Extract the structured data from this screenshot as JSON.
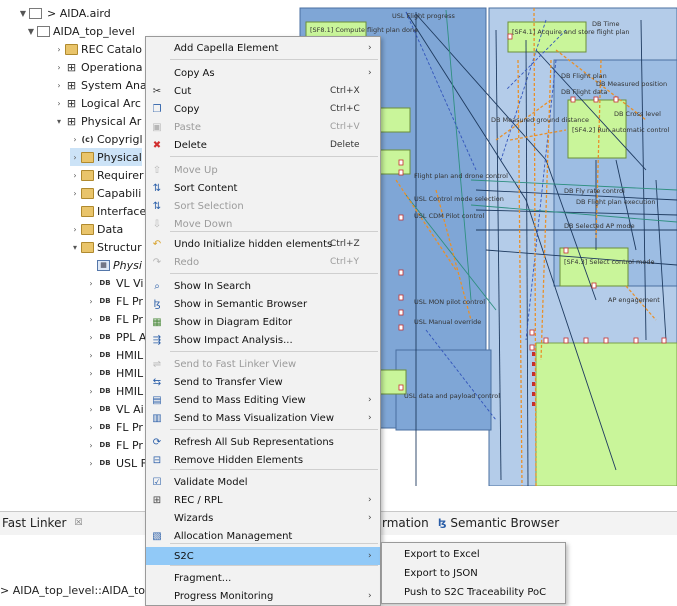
{
  "tree": {
    "rows": [
      {
        "label": "AIDA.aird",
        "icon": "doc-icon",
        "glyph": "",
        "prefix": "▾  ▤ >"
      },
      {
        "label": "AIDA_top_level",
        "icon": "doc-icon",
        "glyph": ""
      },
      {
        "label": "REC Catalo",
        "icon": "folder-icon",
        "glyph": ""
      },
      {
        "label": "Operationa",
        "icon": "grid-icon",
        "glyph": "⊞"
      },
      {
        "label": "System Ana",
        "icon": "grid-icon",
        "glyph": "⊞"
      },
      {
        "label": "Logical Arc",
        "icon": "grid-icon",
        "glyph": "⊞"
      },
      {
        "label": "Physical Ar",
        "icon": "grid-icon",
        "glyph": "⊞"
      },
      {
        "label": "Copyrigl",
        "icon": "copyright-icon",
        "glyph": "(c)"
      },
      {
        "label": "Physical",
        "icon": "folder-icon",
        "glyph": ""
      },
      {
        "label": "Requirer",
        "icon": "folder-icon",
        "glyph": ""
      },
      {
        "label": "Capabili",
        "icon": "folder-icon",
        "glyph": ""
      },
      {
        "label": "Interface",
        "icon": "folder-icon",
        "glyph": ""
      },
      {
        "label": "Data",
        "icon": "folder-icon",
        "glyph": ""
      },
      {
        "label": "Structur",
        "icon": "folder-icon",
        "glyph": ""
      },
      {
        "label": "Physi",
        "icon": "diagram-icon",
        "glyph": "▦"
      },
      {
        "label": "VL Vi",
        "icon": "db-icon",
        "glyph": "DB"
      },
      {
        "label": "FL Pr",
        "icon": "db-icon",
        "glyph": "DB"
      },
      {
        "label": "FL Pr",
        "icon": "db-icon",
        "glyph": "DB"
      },
      {
        "label": "PPL A",
        "icon": "db-icon",
        "glyph": "DB"
      },
      {
        "label": "HMIL",
        "icon": "db-icon",
        "glyph": "DB"
      },
      {
        "label": "HMIL",
        "icon": "db-icon",
        "glyph": "DB"
      },
      {
        "label": "HMIL",
        "icon": "db-icon",
        "glyph": "DB"
      },
      {
        "label": "VL Ai",
        "icon": "db-icon",
        "glyph": "DB"
      },
      {
        "label": "FL Pr",
        "icon": "db-icon",
        "glyph": "DB"
      },
      {
        "label": "FL Pr",
        "icon": "db-icon",
        "glyph": "DB"
      },
      {
        "label": "USL F",
        "icon": "db-icon",
        "glyph": "DB"
      }
    ]
  },
  "diagram": {
    "labels": [
      "[SF8.1] Compute flight plan done",
      "USL Flight progress",
      "[SF4.1] Acquire and store flight plan",
      "DB Time",
      "DB Flight plan",
      "DB Measured position",
      "DB Flight data",
      "DB Measured ground distance",
      "[SF4.2] Run automatic control",
      "DB Cross level",
      "Flight plan and drone control",
      "USL Control mode selection",
      "USL CDM Pilot control",
      "DB Flight plan execution",
      "DB Selected AP mode",
      "[SF4.3] Select control mode",
      "AP engagement",
      "USL MON pilot control",
      "USL Manual override",
      "USL data and payload control",
      "DB Fly rate control"
    ]
  },
  "menu": {
    "items": [
      {
        "label": "Add Capella Element",
        "shortcut": "",
        "arrow": "›",
        "icon": "none"
      },
      {
        "label": "Copy As",
        "shortcut": "",
        "arrow": "›",
        "icon": "none"
      },
      {
        "label": "Cut",
        "shortcut": "Ctrl+X",
        "arrow": "",
        "icon": "cut-icon"
      },
      {
        "label": "Copy",
        "shortcut": "Ctrl+C",
        "arrow": "",
        "icon": "copy-icon"
      },
      {
        "label": "Paste",
        "shortcut": "Ctrl+V",
        "arrow": "",
        "icon": "paste-icon"
      },
      {
        "label": "Delete",
        "shortcut": "Delete",
        "arrow": "",
        "icon": "delete-icon"
      },
      {
        "label": "Move Up",
        "shortcut": "",
        "arrow": "",
        "icon": "move-up-icon"
      },
      {
        "label": "Sort Content",
        "shortcut": "",
        "arrow": "",
        "icon": "sort-icon"
      },
      {
        "label": "Sort Selection",
        "shortcut": "",
        "arrow": "",
        "icon": "sort-icon"
      },
      {
        "label": "Move Down",
        "shortcut": "",
        "arrow": "",
        "icon": "move-down-icon"
      },
      {
        "label": "Undo Initialize hidden elements",
        "shortcut": "Ctrl+Z",
        "arrow": "",
        "icon": "undo-icon"
      },
      {
        "label": "Redo",
        "shortcut": "Ctrl+Y",
        "arrow": "",
        "icon": "redo-icon"
      },
      {
        "label": "Show In Search",
        "shortcut": "",
        "arrow": "",
        "icon": "search-icon"
      },
      {
        "label": "Show in Semantic Browser",
        "shortcut": "",
        "arrow": "",
        "icon": "browser-icon"
      },
      {
        "label": "Show in Diagram Editor",
        "shortcut": "",
        "arrow": "",
        "icon": "diagram-icon"
      },
      {
        "label": "Show Impact Analysis...",
        "shortcut": "",
        "arrow": "",
        "icon": "impact-icon"
      },
      {
        "label": "Send to Fast Linker View",
        "shortcut": "",
        "arrow": "",
        "icon": "linker-icon"
      },
      {
        "label": "Send to Transfer View",
        "shortcut": "",
        "arrow": "",
        "icon": "transfer-icon"
      },
      {
        "label": "Send to Mass Editing View",
        "shortcut": "",
        "arrow": "›",
        "icon": "mass-edit-icon"
      },
      {
        "label": "Send to Mass Visualization View",
        "shortcut": "",
        "arrow": "›",
        "icon": "mass-view-icon"
      },
      {
        "label": "Refresh All Sub Representations",
        "shortcut": "",
        "arrow": "",
        "icon": "refresh-icon"
      },
      {
        "label": "Remove Hidden Elements",
        "shortcut": "",
        "arrow": "",
        "icon": "remove-icon"
      },
      {
        "label": "Validate Model",
        "shortcut": "",
        "arrow": "",
        "icon": "validate-icon"
      },
      {
        "label": "REC / RPL",
        "shortcut": "",
        "arrow": "›",
        "icon": "grid-icon"
      },
      {
        "label": "Wizards",
        "shortcut": "",
        "arrow": "›",
        "icon": "none"
      },
      {
        "label": "Allocation Management",
        "shortcut": "",
        "arrow": "",
        "icon": "allocation-icon"
      },
      {
        "label": "S2C",
        "shortcut": "",
        "arrow": "›",
        "icon": "none"
      },
      {
        "label": "Fragment...",
        "shortcut": "",
        "arrow": "",
        "icon": "none"
      },
      {
        "label": "Progress Monitoring",
        "shortcut": "",
        "arrow": "›",
        "icon": "none"
      }
    ]
  },
  "submenu": {
    "items": [
      {
        "label": "Export to Excel"
      },
      {
        "label": "Export to JSON"
      },
      {
        "label": "Push to S2C Traceability PoC"
      }
    ]
  },
  "bottom": {
    "fast_linker_tab": "Fast Linker",
    "fast_linker_close": "☒",
    "information_tab": "rmation",
    "semantic_browser_tab": "Semantic Browser",
    "status_path": "AIDA_top_level::AIDA_to"
  },
  "colors": {
    "menu_bg": "#f2f2f2",
    "highlight": "#91c9f7",
    "tree_selection": "#cce3f7",
    "diagram_blue": "#7fa6d6",
    "diagram_lightblue": "#b4cce9",
    "function_green": "#c9f59a",
    "flow_orange": "#e8902a"
  }
}
